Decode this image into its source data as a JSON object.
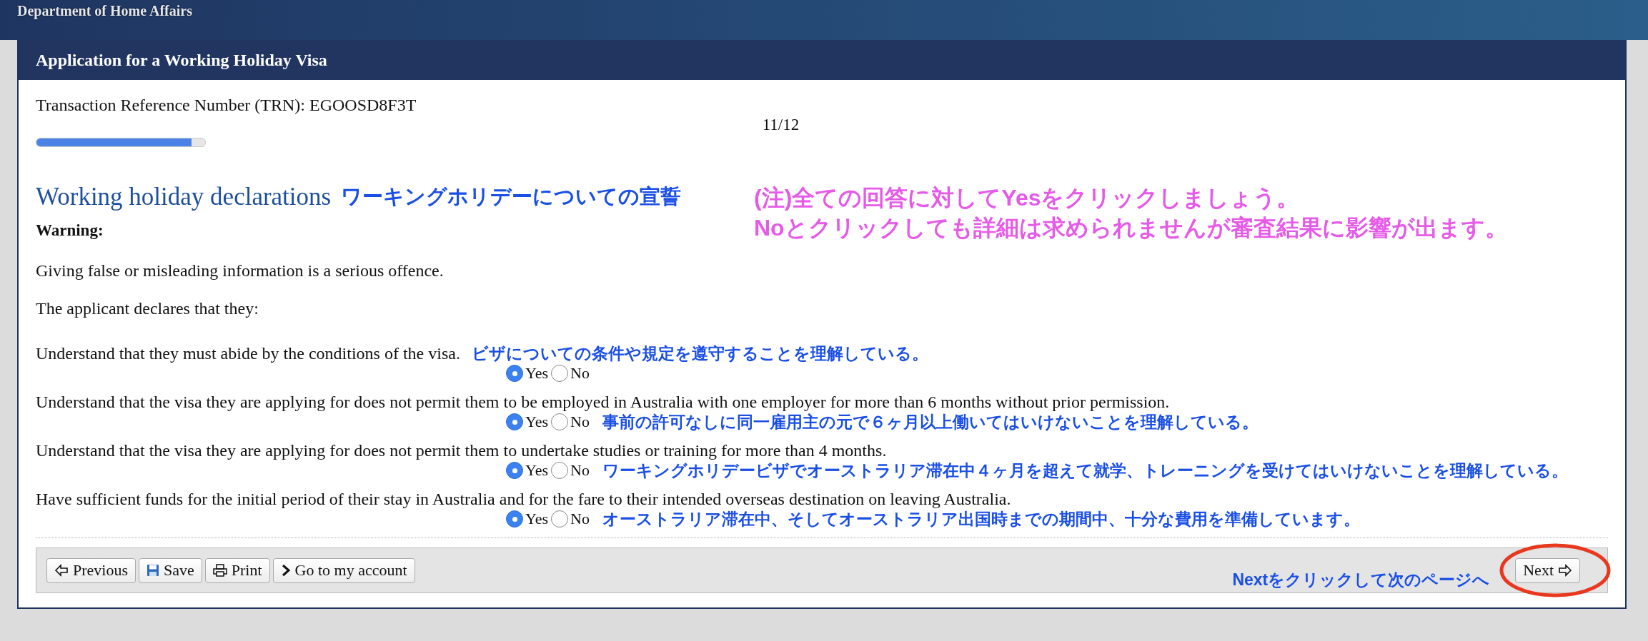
{
  "header": {
    "title": "Department of Home Affairs"
  },
  "panel": {
    "title": "Application for a Working Holiday Visa"
  },
  "trn": "Transaction Reference Number (TRN): EGOOSD8F3T",
  "progress": {
    "step": "11/12",
    "level": 0.92
  },
  "heading": "Working holiday declarations",
  "heading_annotation": "ワーキングホリデーについての宣誓",
  "note": [
    "(注)全ての回答に対してYesをクリックしましょう。",
    "Noとクリックしても詳細は求められませんが審査結果に影響が出ます。"
  ],
  "warning_label": "Warning:",
  "warning_text": "Giving false or misleading information is a serious offence.",
  "intro": "The applicant declares that they:",
  "questions": [
    {
      "text": "Understand that they must abide by the conditions of the visa.",
      "annotation": "ビザについての条件や規定を遵守することを理解している。",
      "kind": "inline",
      "options": [
        {
          "label": "Yes",
          "selected": true
        },
        {
          "label": "No",
          "selected": false
        }
      ]
    },
    {
      "text": "Understand that the visa they are applying for does not permit them to be employed in Australia with one employer for more than 6 months without prior permission.",
      "annotation": "事前の許可なしに同一雇用主の元で６ヶ月以上働いてはいけないことを理解している。",
      "kind": "below",
      "options": [
        {
          "label": "Yes",
          "selected": true
        },
        {
          "label": "No",
          "selected": false
        }
      ]
    },
    {
      "text": "Understand that the visa they are applying for does not permit them to undertake studies or training for more than 4 months.",
      "annotation": "ワーキングホリデービザでオーストラリア滞在中４ヶ月を超えて就学、トレーニングを受けてはいけないことを理解している。",
      "kind": "below",
      "options": [
        {
          "label": "Yes",
          "selected": true
        },
        {
          "label": "No",
          "selected": false
        }
      ]
    },
    {
      "text": "Have sufficient funds for the initial period of their stay in Australia and for the fare to their intended overseas destination on leaving Australia.",
      "annotation": "オーストラリア滞在中、そしてオーストラリア出国時までの期間中、十分な費用を準備しています。",
      "kind": "below",
      "options": [
        {
          "label": "Yes",
          "selected": true
        },
        {
          "label": "No",
          "selected": false
        }
      ]
    }
  ],
  "nav_buttons": [
    {
      "label": "Previous"
    },
    {
      "label": "Save"
    },
    {
      "label": "Print"
    },
    {
      "label": "Go to my account"
    }
  ],
  "next_annotation": "Nextをクリックして次のページへ",
  "next_button": {
    "label": "Next",
    "highlighted": true
  }
}
